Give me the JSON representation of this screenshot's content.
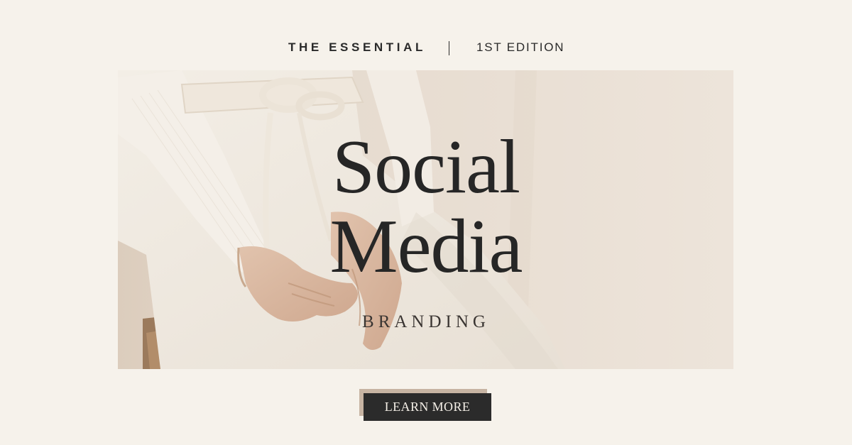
{
  "header": {
    "kicker": "THE ESSENTIAL",
    "separator": "|",
    "edition": "1ST EDITION"
  },
  "hero": {
    "title_line1": "Social",
    "title_line2": "Media",
    "subtitle": "BRANDING",
    "image": "woman-in-cream-knit-dress-photo"
  },
  "cta": {
    "label": "LEARN MORE"
  },
  "colors": {
    "background": "#f6f2eb",
    "text": "#262626",
    "button": "#2b2b2b",
    "button_accent": "#c7b4a3"
  }
}
